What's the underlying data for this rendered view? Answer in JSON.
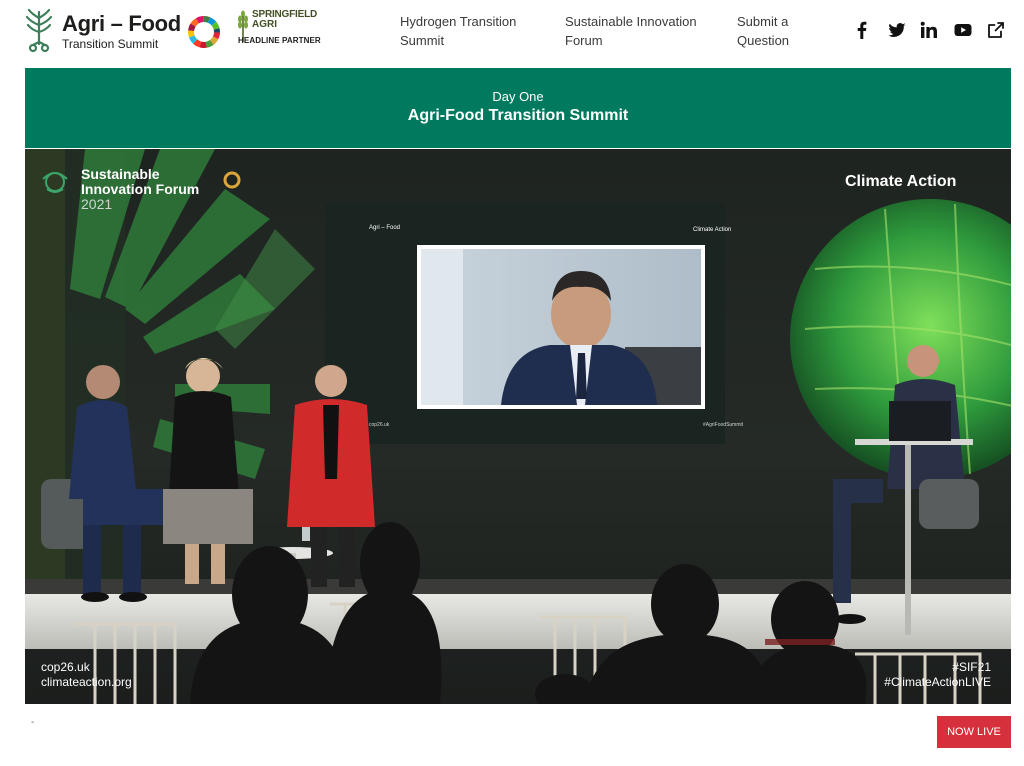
{
  "header": {
    "brand_name": "Agri – Food",
    "brand_sub": "Transition Summit",
    "partner": {
      "line1": "SPRINGFIELD",
      "line2": "AGRI",
      "tag": "HEADLINE PARTNER"
    },
    "nav": [
      {
        "label": "Hydrogen Transition Summit"
      },
      {
        "label": "Sustainable Innovation Forum"
      },
      {
        "label": "Submit a Question"
      }
    ],
    "social_icons": [
      "facebook-icon",
      "twitter-icon",
      "linkedin-icon",
      "youtube-icon",
      "external-link-icon"
    ],
    "colors": {
      "brand_green": "#3c7f5a",
      "text": "#1d1d1b"
    }
  },
  "banner": {
    "day": "Day One",
    "title": "Agri-Food Transition Summit",
    "color": "#007a5e"
  },
  "video": {
    "overlay_top_left": {
      "line1": "Sustainable",
      "line2": "Innovation Forum",
      "line3": "2021"
    },
    "overlay_top_right": "Climate Action",
    "overlay_bottom_left": {
      "line1": "cop26.uk",
      "line2": "climateaction.org"
    },
    "overlay_bottom_right": {
      "line1": "#SIF21",
      "line2": "#ClimateActionLIVE"
    },
    "screen_labels": {
      "left_top": "Agri – Food",
      "right_top": "Climate Action",
      "left_bottom": "cop26.uk",
      "right_bottom": "#AgriFoodSummit"
    }
  },
  "footer": {
    "dash": "-",
    "live_label": "NOW LIVE",
    "live_color": "#d6303c"
  }
}
